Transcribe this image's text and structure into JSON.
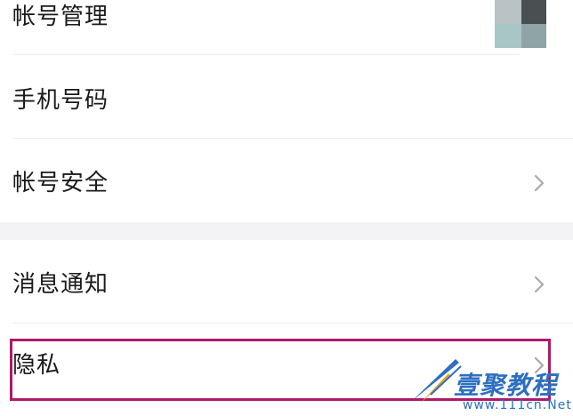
{
  "settings": {
    "items": [
      {
        "label": "帐号管理"
      },
      {
        "label": "手机号码"
      },
      {
        "label": "帐号安全"
      },
      {
        "label": "消息通知"
      },
      {
        "label": "隐私"
      }
    ]
  },
  "watermark": {
    "brand": "壹聚教程",
    "site": "www.111cn.Net"
  },
  "colors": {
    "highlight": "#b0186a",
    "section_gap": "#f3f3f5",
    "watermark": "#2d6fc0"
  },
  "icons": {
    "row_arrow": "chevron-right-icon",
    "avatar": "avatar-thumbnail"
  }
}
